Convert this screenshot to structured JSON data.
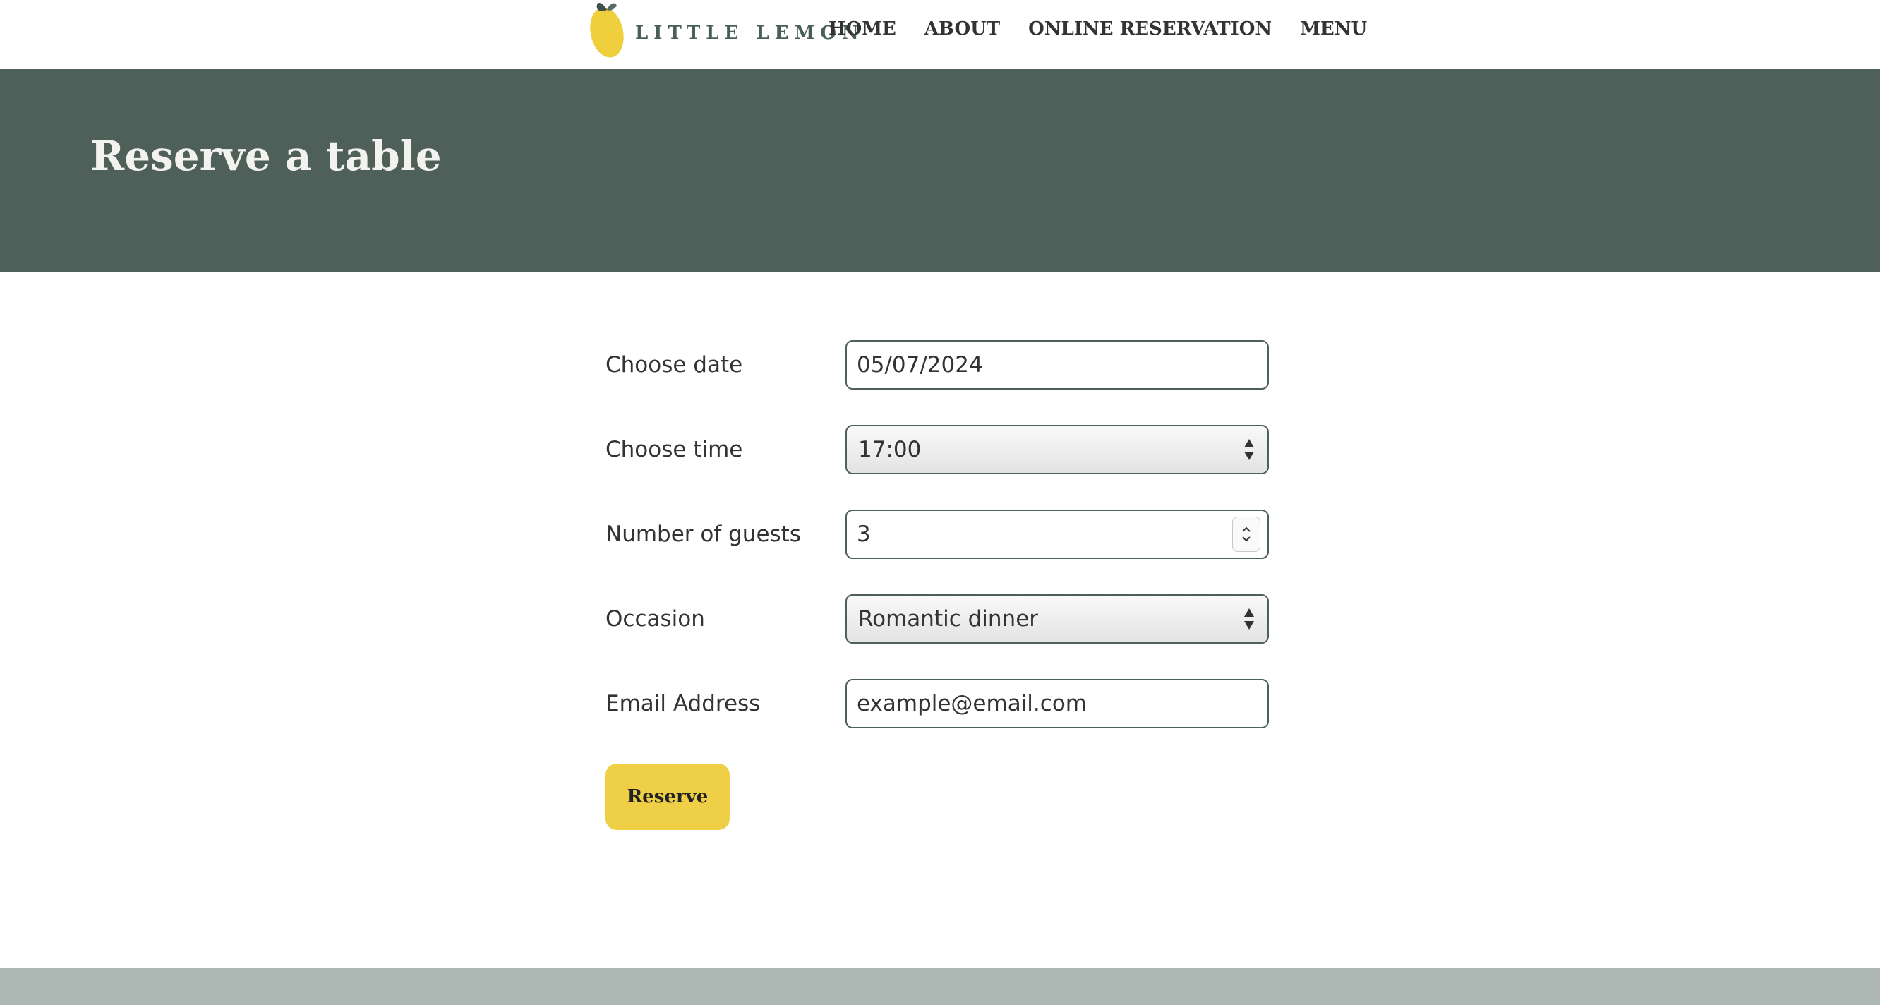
{
  "header": {
    "logo_text": "LITTLE LEMON",
    "nav": [
      {
        "label": "HOME"
      },
      {
        "label": "ABOUT"
      },
      {
        "label": "ONLINE RESERVATION"
      },
      {
        "label": "MENU"
      }
    ]
  },
  "hero": {
    "title": "Reserve a table"
  },
  "form": {
    "date": {
      "label": "Choose date",
      "value": "05/07/2024"
    },
    "time": {
      "label": "Choose time",
      "value": "17:00"
    },
    "guests": {
      "label": "Number of guests",
      "value": "3"
    },
    "occasion": {
      "label": "Occasion",
      "value": "Romantic dinner"
    },
    "email": {
      "label": "Email Address",
      "placeholder": "example@email.com"
    },
    "submit_label": "Reserve"
  },
  "colors": {
    "brand_green": "#495e57",
    "brand_yellow": "#eecf45",
    "hero_bg": "#4f5f59",
    "footer_bg": "#adb8b5"
  },
  "icons": {
    "logo": "lemon-icon",
    "select": "select-arrows-icon",
    "number": "number-spinner-icon"
  }
}
